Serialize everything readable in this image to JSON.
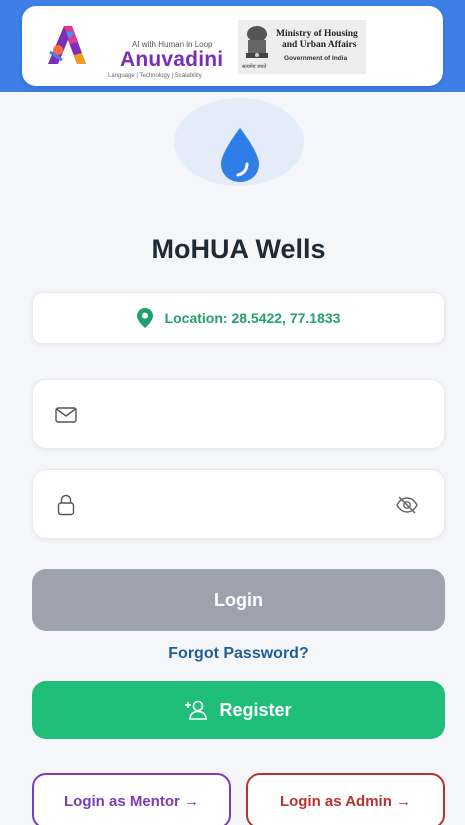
{
  "header": {
    "anuvadini": {
      "tagline": "AI with Human in Loop",
      "name": "Anuvadini",
      "subtitle": "Language | Technology | Scalability"
    },
    "ministry": {
      "line1": "Ministry of Housing",
      "line2": "and Urban Affairs",
      "line3": "Government of India",
      "emblem_caption": "सत्यमेव जयते"
    },
    "band_color": "#3d7fe6"
  },
  "app": {
    "title": "MoHUA Wells",
    "logo_icon": "water-drop-icon"
  },
  "location": {
    "text": "Location: 28.5422, 77.1833",
    "icon": "map-pin-icon",
    "color": "#22a06b"
  },
  "form": {
    "email": {
      "value": "",
      "placeholder": "",
      "icon": "mail-icon"
    },
    "password": {
      "value": "",
      "placeholder": "",
      "icon": "lock-icon",
      "toggle_icon": "eye-off-icon"
    }
  },
  "actions": {
    "login_label": "Login",
    "forgot_label": "Forgot Password?",
    "register_label": "Register",
    "register_icon": "user-plus-icon",
    "mentor_label": "Login as Mentor →",
    "admin_label": "Login as Admin →"
  },
  "colors": {
    "login_disabled": "#9ca3af",
    "register": "#1fbf7a",
    "mentor": "#7e3ab8",
    "admin": "#b8322f",
    "link": "#1f5f96"
  }
}
